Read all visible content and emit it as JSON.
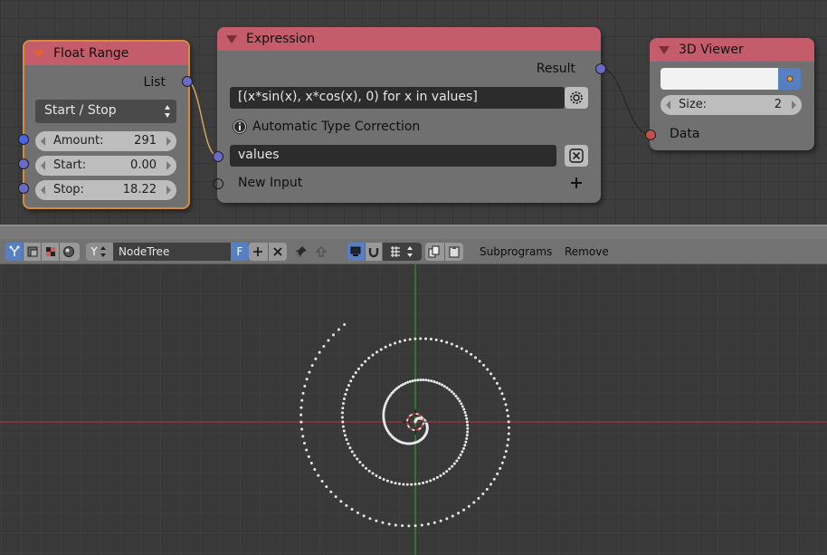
{
  "nodes": {
    "float_range": {
      "title": "Float Range",
      "output_label": "List",
      "mode": "Start / Stop",
      "amount_label": "Amount:",
      "amount_value": "291",
      "start_label": "Start:",
      "start_value": "0.00",
      "stop_label": "Stop:",
      "stop_value": "18.22"
    },
    "expression": {
      "title": "Expression",
      "output_label": "Result",
      "expression_text": "[(x*sin(x), x*cos(x), 0) for x in values]",
      "type_correction_label": "Automatic Type Correction",
      "input_name": "values",
      "new_input_label": "New Input"
    },
    "viewer": {
      "title": "3D Viewer",
      "size_label": "Size:",
      "size_value": "2",
      "input_label": "Data"
    }
  },
  "header": {
    "tree_name": "NodeTree",
    "fake_user_label": "F",
    "subprograms_label": "Subprograms",
    "remove_label": "Remove"
  },
  "viewport": {
    "spiral_point_count": 291,
    "spiral_start": 0.0,
    "spiral_stop": 18.22
  },
  "colors": {
    "node_header": "#c55c6c",
    "node_body": "#707070",
    "selected_outline": "#d98a3a",
    "socket_float": "#6a6ac8",
    "socket_object": "#c45050",
    "x_axis": "#a03535",
    "y_axis": "#2f9a2f",
    "point": "#e8e8e8"
  }
}
